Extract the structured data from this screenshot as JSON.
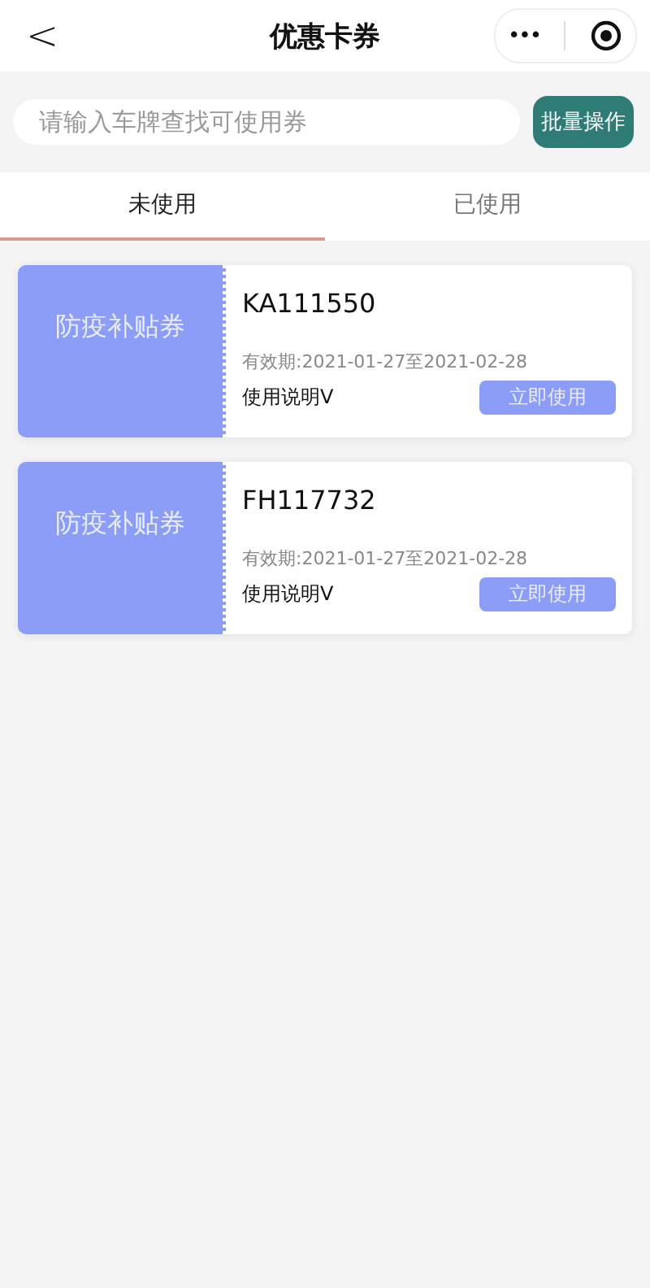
{
  "header": {
    "back": "<",
    "title": "优惠卡券",
    "more": "•••"
  },
  "search": {
    "placeholder": "请输入车牌查找可使用券",
    "button": "批量操作"
  },
  "tabs": [
    {
      "label": "未使用",
      "selected": true
    },
    {
      "label": "已使用",
      "selected": false
    }
  ],
  "coupons": [
    {
      "name": "防疫补贴券",
      "plate": "KA111550",
      "validity": "有效期:2021-01-27至2021-02-28",
      "instructions": "使用说明V",
      "action": "立即使用"
    },
    {
      "name": "防疫补贴券",
      "plate": "FH117732",
      "validity": "有效期:2021-01-27至2021-02-28",
      "instructions": "使用说明V",
      "action": "立即使用"
    }
  ]
}
